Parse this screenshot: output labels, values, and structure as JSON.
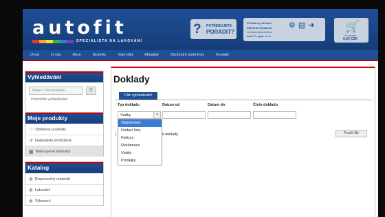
{
  "header": {
    "logo": "autofit",
    "tagline": "SPECIALISTA NA LAKOVÁNÍ",
    "stripe_colors": [
      "#e23b2e",
      "#f5a623",
      "#f3e21f",
      "#3fae49",
      "#2f7fd1",
      "#7b3fb3"
    ],
    "advice": {
      "top": "POTŘEBUJETE",
      "bottom": "PORADIT?"
    },
    "user": {
      "label": "Přihlášený uživatel",
      "name": "Kateřina Hejnalová",
      "email": "hejnalova@autofit.cz",
      "company": "Auto FI, spol. s r.o."
    },
    "cart": {
      "count": "0 položek",
      "price": "0,00 CZK"
    }
  },
  "nav": [
    "Úvod",
    "O nás",
    "Akce",
    "Novinky",
    "Výprodej",
    "Aktuality",
    "Obchodní podmínky",
    "Kontakt"
  ],
  "sidebar": {
    "search": {
      "title": "Vyhledávání",
      "placeholder": "Název / kód produktu...",
      "advanced": "Pokročilé vyhledávání"
    },
    "products": {
      "title": "Moje produkty",
      "items": [
        "Oblíbené produkty",
        "Naposledy prohlížené",
        "Nakoupené produkty"
      ]
    },
    "catalog": {
      "title": "Katalog",
      "items": [
        "Doprovodný materiál",
        "Lakování",
        "Vybavení"
      ]
    }
  },
  "main": {
    "title": "Doklady",
    "filter_tab": "Filtr vyhledávání",
    "labels": {
      "type": "Typ dokladu",
      "date_from": "Datum od",
      "date_to": "Datum do",
      "number": "Číslo dokladu"
    },
    "type_value": "Vratky",
    "options": [
      "Objednávky",
      "Dodací listy",
      "Faktury",
      "Reklamace",
      "Vratky",
      "Prodejky"
    ],
    "selected_option": "Objednávky",
    "hidden_text": "né doklady",
    "apply": "Použít filtr"
  },
  "colors": {
    "brand_blue": "#1f4f96",
    "accent_red": "#cc0000",
    "selected": "#3a7bd5"
  }
}
